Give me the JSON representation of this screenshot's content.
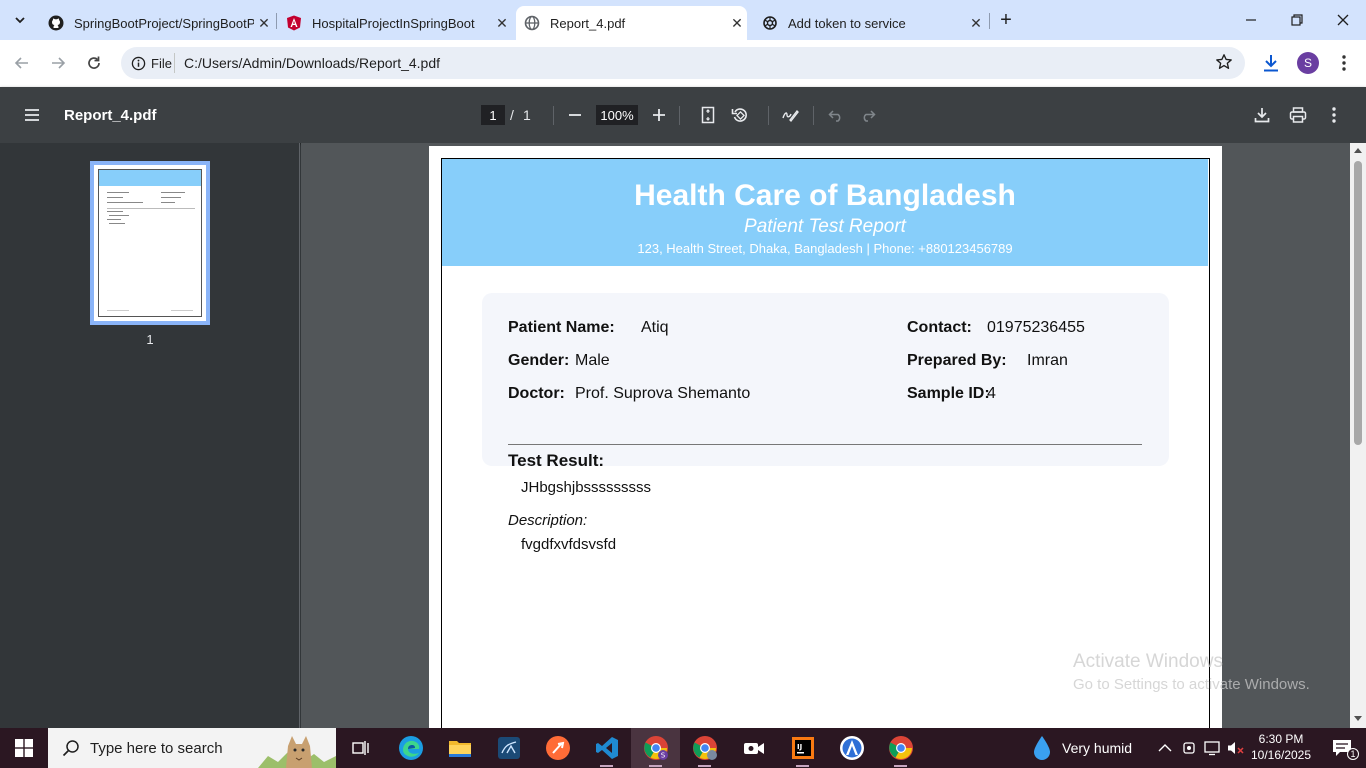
{
  "browser": {
    "tabs": [
      {
        "title": "SpringBootProject/SpringBootP",
        "icon": "github-icon",
        "active": false
      },
      {
        "title": "HospitalProjectInSpringBoot",
        "icon": "angular-icon",
        "active": false
      },
      {
        "title": "Report_4.pdf",
        "icon": "globe-icon",
        "active": true
      },
      {
        "title": "Add token to service",
        "icon": "openai-icon",
        "active": false
      }
    ],
    "site_chip": "File",
    "url": "C:/Users/Admin/Downloads/Report_4.pdf",
    "profile_initial": "S"
  },
  "pdf_viewer": {
    "file_name": "Report_4.pdf",
    "current_page": "1",
    "page_separator": "/",
    "total_pages": "1",
    "zoom": "100%",
    "thumbnail_label": "1"
  },
  "report": {
    "hospital_name": "Health Care of Bangladesh",
    "report_title": "Patient Test Report",
    "address_line": "123, Health Street, Dhaka, Bangladesh | Phone: +880123456789",
    "fields": {
      "patient_name_label": "Patient Name:",
      "patient_name": "Atiq",
      "gender_label": "Gender:",
      "gender": "Male",
      "doctor_label": "Doctor:",
      "doctor": "Prof. Suprova Shemanto",
      "contact_label": "Contact:",
      "contact": "01975236455",
      "prepared_by_label": "Prepared By:",
      "prepared_by": "Imran",
      "sample_id_label": "Sample ID:",
      "sample_id": "4"
    },
    "test_result_label": "Test Result:",
    "test_result": "JHbgshjbsssssssss",
    "description_label": "Description:",
    "description": "fvgdfxvfdsvsfd"
  },
  "watermark": {
    "title": "Activate Windows",
    "subtitle": "Go to Settings to activate Windows."
  },
  "taskbar": {
    "search_placeholder": "Type here to search",
    "weather": "Very humid",
    "time": "6:30 PM",
    "date": "10/16/2025",
    "notification_count": "1"
  },
  "colors": {
    "tabstrip": "#d3e3fd",
    "report_header": "#87cefa",
    "viewer_bg": "#525659",
    "pdf_toolbar": "#3c4043",
    "taskbar": "#2b1722"
  }
}
